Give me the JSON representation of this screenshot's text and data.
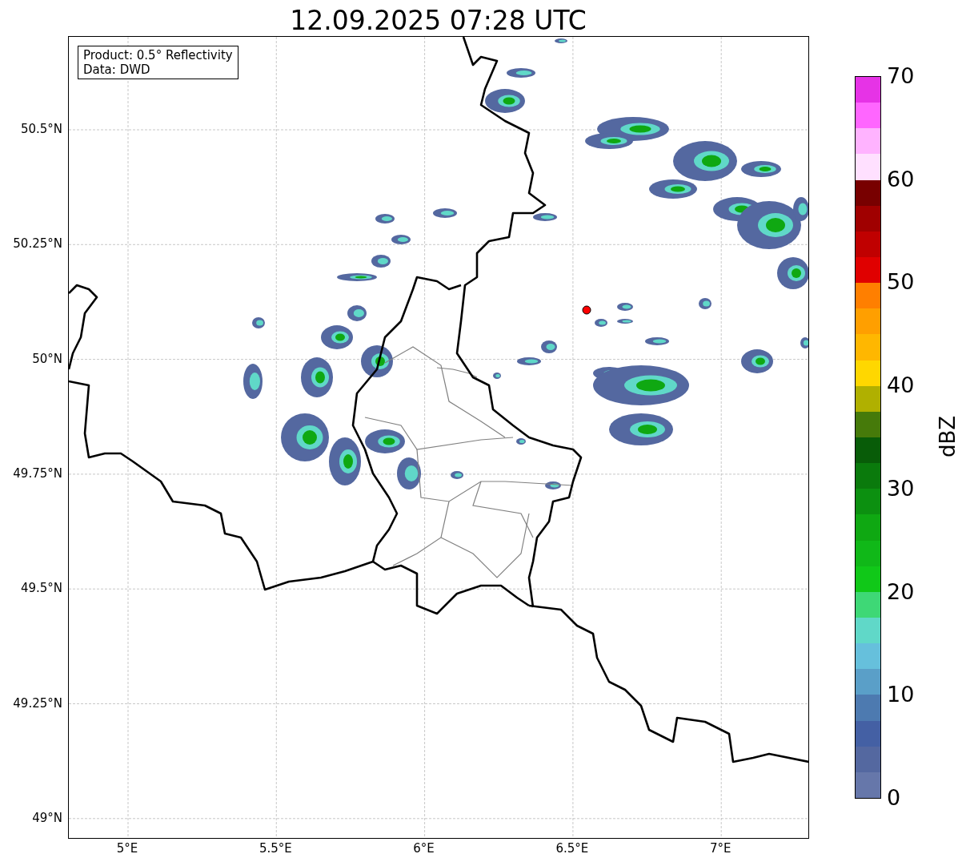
{
  "title": "12.09.2025 07:28 UTC",
  "info_box": {
    "lines": [
      "Product: 0.5° Reflectivity",
      "Data: DWD"
    ]
  },
  "map": {
    "lat_ticks": [
      "50.5°N",
      "50.25°N",
      "50°N",
      "49.75°N",
      "49.5°N",
      "49.25°N",
      "49°N"
    ],
    "lon_ticks": [
      "5°E",
      "5.5°E",
      "6°E",
      "6.5°E",
      "7°E"
    ]
  },
  "colorbar": {
    "label": "dBZ",
    "ticks": [
      "70",
      "60",
      "50",
      "40",
      "30",
      "20",
      "10",
      "0"
    ],
    "segments": [
      {
        "color": "#6677aa"
      },
      {
        "color": "#5468a0"
      },
      {
        "color": "#4460a4"
      },
      {
        "color": "#4d7ab0"
      },
      {
        "color": "#5a9fc8"
      },
      {
        "color": "#66c0dc"
      },
      {
        "color": "#60d8c8"
      },
      {
        "color": "#3ed876"
      },
      {
        "color": "#10c818"
      },
      {
        "color": "#10b818"
      },
      {
        "color": "#0fa812"
      },
      {
        "color": "#0c9010"
      },
      {
        "color": "#0a7a0c"
      },
      {
        "color": "#085c08"
      },
      {
        "color": "#467a0a"
      },
      {
        "color": "#b0b000"
      },
      {
        "color": "#ffd700"
      },
      {
        "color": "#ffb700"
      },
      {
        "color": "#ff9f00"
      },
      {
        "color": "#ff7f00"
      },
      {
        "color": "#e00000"
      },
      {
        "color": "#c00000"
      },
      {
        "color": "#a00000"
      },
      {
        "color": "#780000"
      },
      {
        "color": "#ffe0ff"
      },
      {
        "color": "#ffb3ff"
      },
      {
        "color": "#ff66ff"
      },
      {
        "color": "#e633e6"
      }
    ]
  }
}
